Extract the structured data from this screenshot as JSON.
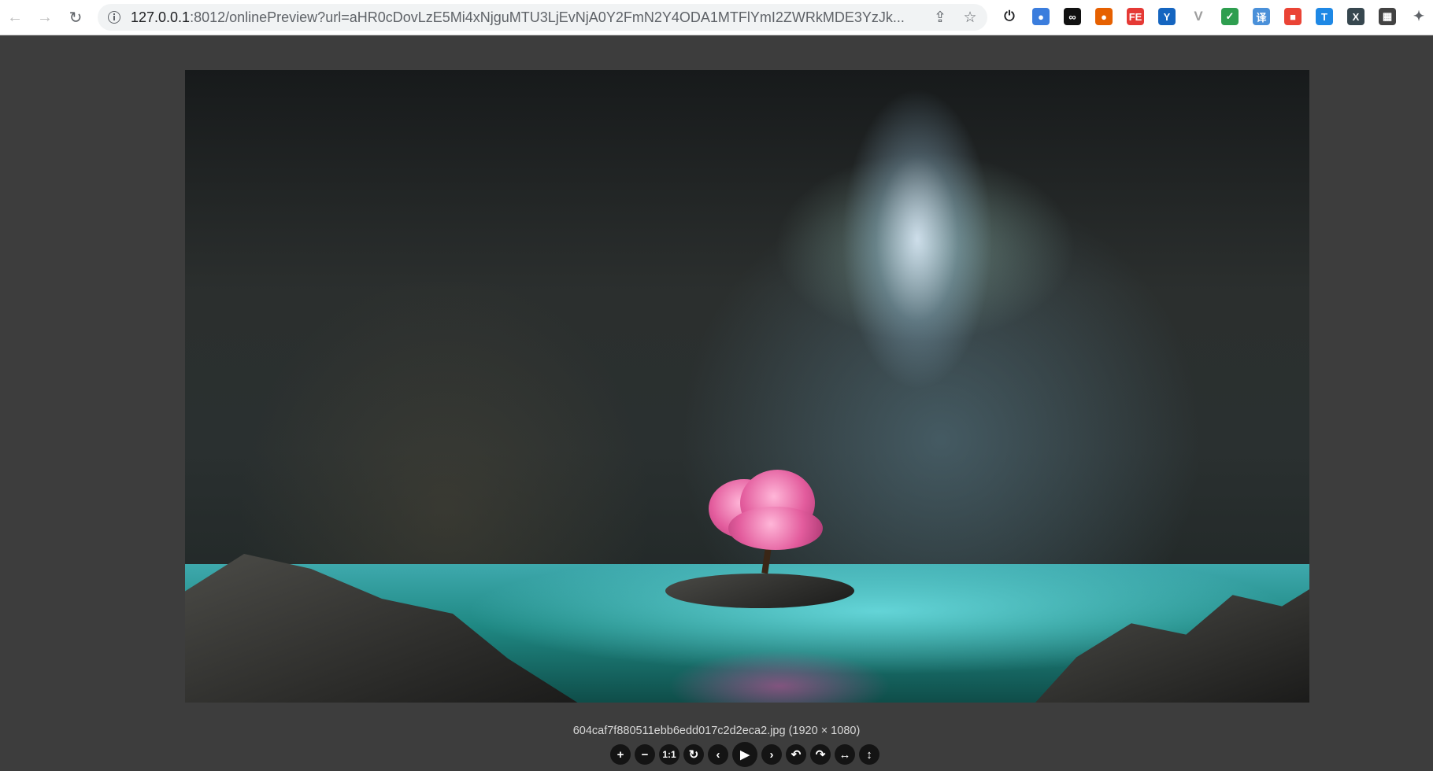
{
  "browser": {
    "url_host": "127.0.0.1",
    "url_rest": ":8012/onlinePreview?url=aHR0cDovLzE5Mi4xNjguMTU3LjEvNjA0Y2FmN2Y4ODA1MTFlYmI2ZWRkMDE3YzJk...",
    "extensions": [
      {
        "icon": "power-icon",
        "glyph": "⏻",
        "color": "#202124"
      },
      {
        "icon": "honey-icon",
        "glyph": "●",
        "color": "#3b7ddd"
      },
      {
        "icon": "infinity-icon",
        "glyph": "∞",
        "color": "#111111"
      },
      {
        "icon": "firefox-icon",
        "glyph": "●",
        "color": "#e66000"
      },
      {
        "icon": "fe-icon",
        "glyph": "FE",
        "color": "#e53935"
      },
      {
        "icon": "vue-devtools-icon",
        "glyph": "Y",
        "color": "#1565c0"
      },
      {
        "icon": "vuejs-icon",
        "glyph": "V",
        "color": "#9e9e9e"
      },
      {
        "icon": "shield-check-icon",
        "glyph": "✓",
        "color": "#2e9e4f"
      },
      {
        "icon": "grid-translate-icon",
        "glyph": "译",
        "color": "#4a90d9"
      },
      {
        "icon": "colorful-squares-icon",
        "glyph": "■",
        "color": "#ea4335"
      },
      {
        "icon": "t-icon",
        "glyph": "T",
        "color": "#1e88e5"
      },
      {
        "icon": "x-icon",
        "glyph": "X",
        "color": "#37474f"
      },
      {
        "icon": "qr-code-icon",
        "glyph": "▦",
        "color": "#424242"
      },
      {
        "icon": "puzzle-icon",
        "glyph": "✦",
        "color": "#5f6368"
      }
    ]
  },
  "preview": {
    "caption": "604caf7f880511ebb6edd017c2d2eca2.jpg (1920 × 1080)"
  },
  "viewer_toolbar": [
    {
      "name": "zoom-in-button",
      "icon": "plus-icon",
      "label": "+"
    },
    {
      "name": "zoom-out-button",
      "icon": "minus-icon",
      "label": "−"
    },
    {
      "name": "one-to-one-button",
      "icon": "one-to-one-icon",
      "label": "1:1"
    },
    {
      "name": "reset-button",
      "icon": "reset-icon",
      "label": "↻"
    },
    {
      "name": "prev-button",
      "icon": "chevron-left-icon",
      "label": "‹"
    },
    {
      "name": "play-button",
      "icon": "play-icon",
      "label": "▶"
    },
    {
      "name": "next-button",
      "icon": "chevron-right-icon",
      "label": "›"
    },
    {
      "name": "rotate-left-button",
      "icon": "rotate-left-icon",
      "label": "↶"
    },
    {
      "name": "rotate-right-button",
      "icon": "rotate-right-icon",
      "label": "↷"
    },
    {
      "name": "flip-horizontal-button",
      "icon": "flip-horizontal-icon",
      "label": "↔"
    },
    {
      "name": "flip-vertical-button",
      "icon": "flip-vertical-icon",
      "label": "↕"
    }
  ]
}
